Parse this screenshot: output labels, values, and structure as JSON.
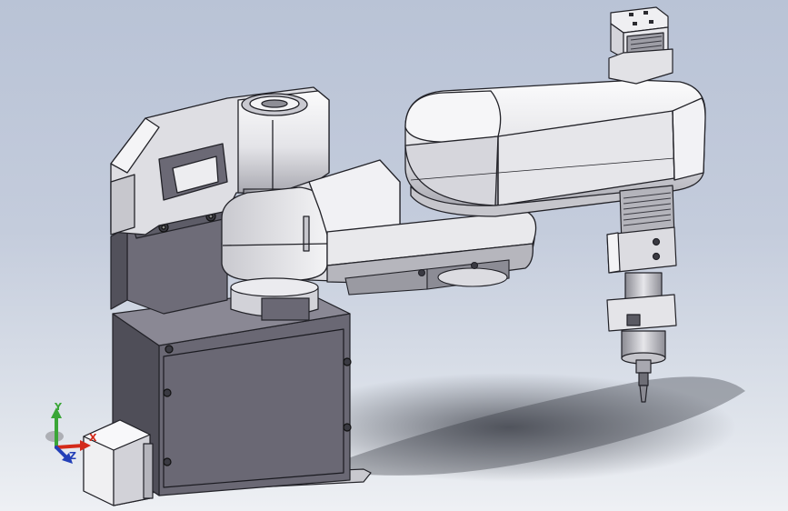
{
  "viewport": {
    "background_top": "#b9c3d6",
    "background_bottom": "#eef0f4"
  },
  "model": {
    "body_fill": "#6e6c78",
    "arm_fill": "#e9e9ec",
    "edge_color": "#222228"
  },
  "triad": {
    "x_label": "X",
    "y_label": "Y",
    "z_label": "Z",
    "x_color": "#d42a1a",
    "y_color": "#3aa637",
    "z_color": "#2340b8"
  }
}
